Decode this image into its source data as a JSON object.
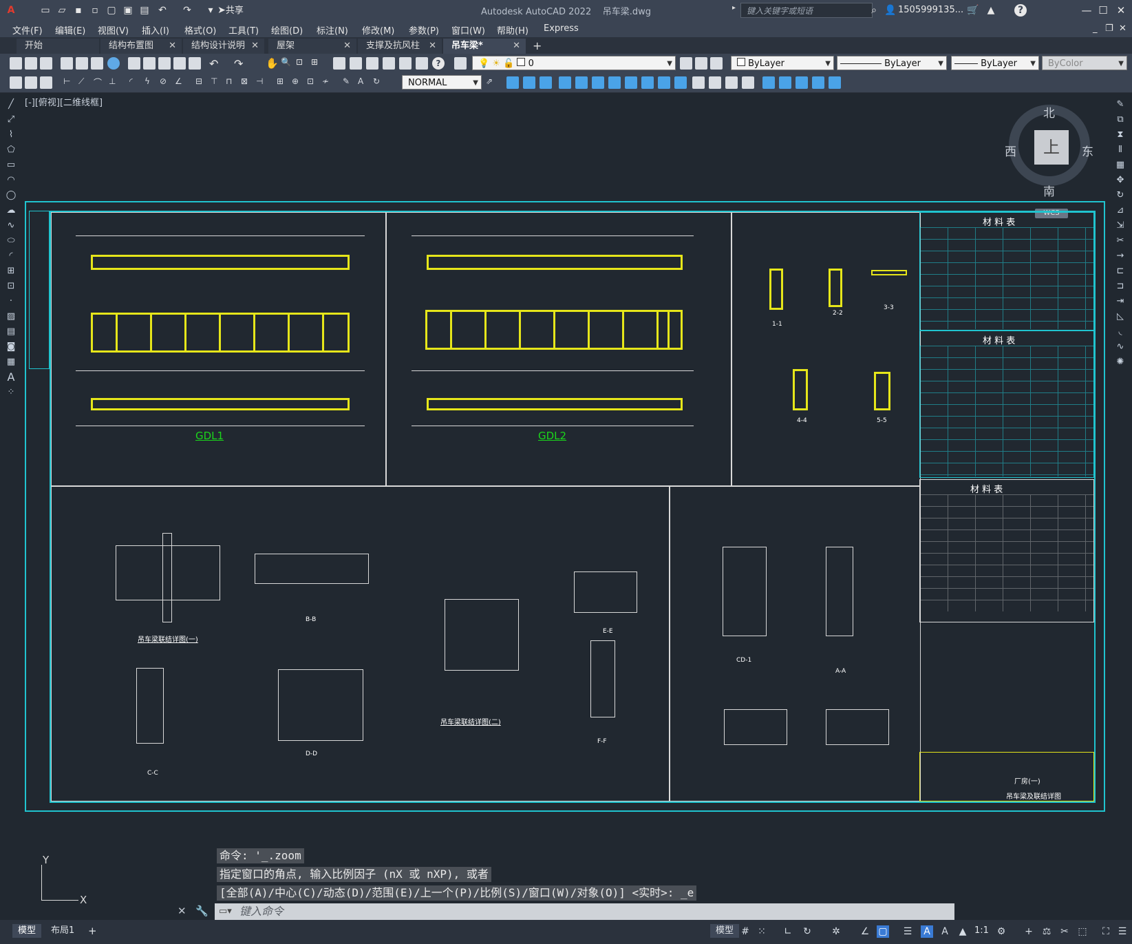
{
  "app": {
    "title": "Autodesk AutoCAD 2022",
    "document": "吊车梁.dwg",
    "search_placeholder": "键入关键字或短语",
    "user": "1505999135...",
    "share_label": "共享"
  },
  "menu": [
    "文件(F)",
    "编辑(E)",
    "视图(V)",
    "插入(I)",
    "格式(O)",
    "工具(T)",
    "绘图(D)",
    "标注(N)",
    "修改(M)",
    "参数(P)",
    "窗口(W)",
    "帮助(H)",
    "Express"
  ],
  "tabs": [
    {
      "label": "开始",
      "closable": false
    },
    {
      "label": "结构布置图",
      "closable": true
    },
    {
      "label": "结构设计说明",
      "closable": true
    },
    {
      "label": "屋架",
      "closable": true
    },
    {
      "label": "支撑及抗风柱",
      "closable": true
    },
    {
      "label": "吊车梁*",
      "closable": true,
      "active": true
    }
  ],
  "toolbar": {
    "layer_value": "0",
    "color_value": "ByLayer",
    "linetype_value": "ByLayer",
    "lineweight_value": "ByLayer",
    "plotstyle_value": "ByColor",
    "dimstyle_value": "NORMAL"
  },
  "viewport": {
    "label": "[-][俯视][二维线框]",
    "compass": {
      "north": "北",
      "south": "南",
      "east": "东",
      "west": "西",
      "top": "上"
    },
    "wcs": "WCS"
  },
  "drawing": {
    "gdl1": "GDL1",
    "gdl2": "GDL2",
    "table1_title": "材 料 表",
    "table2_title": "材 料 表",
    "table3_title": "材 料 表",
    "detail1": "吊车梁联结详图(一)",
    "detail2": "吊车梁联结详图(二)",
    "sec_11": "1-1",
    "sec_22": "2-2",
    "sec_33": "3-3",
    "sec_44": "4-4",
    "sec_55": "5-5",
    "sec_bb": "B-B",
    "sec_cc": "C-C",
    "sec_dd": "D-D",
    "sec_ee": "E-E",
    "sec_ff": "F-F",
    "sec_aa": "A-A",
    "cd1": "CD-1",
    "titleblock_project": "厂房(一)",
    "titleblock_sheet": "吊车梁及联结详图"
  },
  "command": {
    "history": [
      "命令: '_.zoom",
      "指定窗口的角点, 输入比例因子 (nX 或 nXP), 或者",
      "[全部(A)/中心(C)/动态(D)/范围(E)/上一个(P)/比例(S)/窗口(W)/对象(O)] <实时>: _e"
    ],
    "input_placeholder": "键入命令"
  },
  "status": {
    "model_tab": "模型",
    "layout_tab": "布局1",
    "add_tab": "+",
    "model_label": "模型",
    "scale": "1:1"
  },
  "ucs": {
    "x": "X",
    "y": "Y"
  }
}
